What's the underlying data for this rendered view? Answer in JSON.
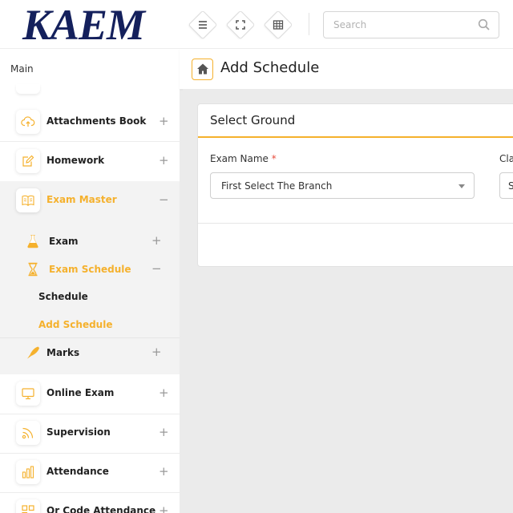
{
  "header": {
    "logo_text": "KAEM",
    "search_placeholder": "Search"
  },
  "sidebar": {
    "section_title": "Main",
    "items": [
      {
        "label": "Attachments Book",
        "toggle": "+",
        "icon": "cloud-upload-icon"
      },
      {
        "label": "Homework",
        "toggle": "+",
        "icon": "edit-icon"
      },
      {
        "label": "Exam Master",
        "toggle": "−",
        "icon": "book-icon"
      },
      {
        "label": "Online Exam",
        "toggle": "+",
        "icon": "monitor-icon"
      },
      {
        "label": "Supervision",
        "toggle": "+",
        "icon": "rss-icon"
      },
      {
        "label": "Attendance",
        "toggle": "+",
        "icon": "bar-chart-icon"
      },
      {
        "label": "Qr Code Attendance",
        "toggle": "+",
        "icon": "qr-code-icon"
      }
    ],
    "exam_master_sub": [
      {
        "label": "Exam",
        "toggle": "+",
        "icon": "flask-icon"
      },
      {
        "label": "Exam Schedule",
        "toggle": "−",
        "icon": "hourglass-icon"
      },
      {
        "label": "Marks",
        "toggle": "+",
        "icon": "pen-icon"
      }
    ],
    "exam_schedule_sub": [
      {
        "label": "Schedule"
      },
      {
        "label": "Add Schedule"
      }
    ]
  },
  "page": {
    "title": "Add Schedule"
  },
  "card": {
    "title": "Select Ground",
    "exam_label": "Exam Name",
    "required_mark": "*",
    "exam_value": "First Select The Branch",
    "class_label": "Cla",
    "class_value": "S"
  },
  "colors": {
    "accent": "#f5b12d",
    "logo": "#14205c",
    "required": "#e74c3c"
  }
}
